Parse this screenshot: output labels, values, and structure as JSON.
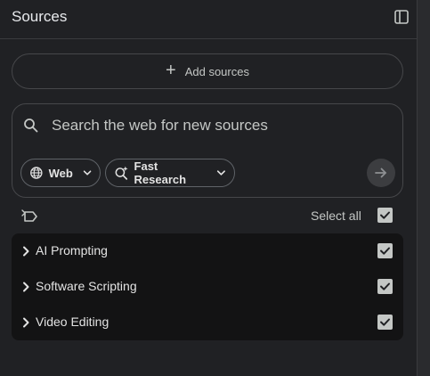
{
  "header": {
    "title": "Sources",
    "collapse_icon": "panel-collapse-icon"
  },
  "add_sources": {
    "label": "Add sources",
    "icon": "plus-icon"
  },
  "search": {
    "placeholder": "Search the web for new sources",
    "value": "",
    "chips": [
      {
        "label": "Web",
        "icon": "globe-icon"
      },
      {
        "label": "Fast Research",
        "icon": "sparkle-search-icon"
      }
    ],
    "submit_icon": "arrow-right-icon"
  },
  "select_all": {
    "label": "Select all",
    "checked": true
  },
  "sources": [
    {
      "label": "AI Prompting",
      "checked": true
    },
    {
      "label": "Software Scripting",
      "checked": true
    },
    {
      "label": "Video Editing",
      "checked": true
    }
  ],
  "colors": {
    "background": "#202124",
    "list_background": "#131314",
    "text": "#e3e3e3",
    "border": "#46474a"
  }
}
